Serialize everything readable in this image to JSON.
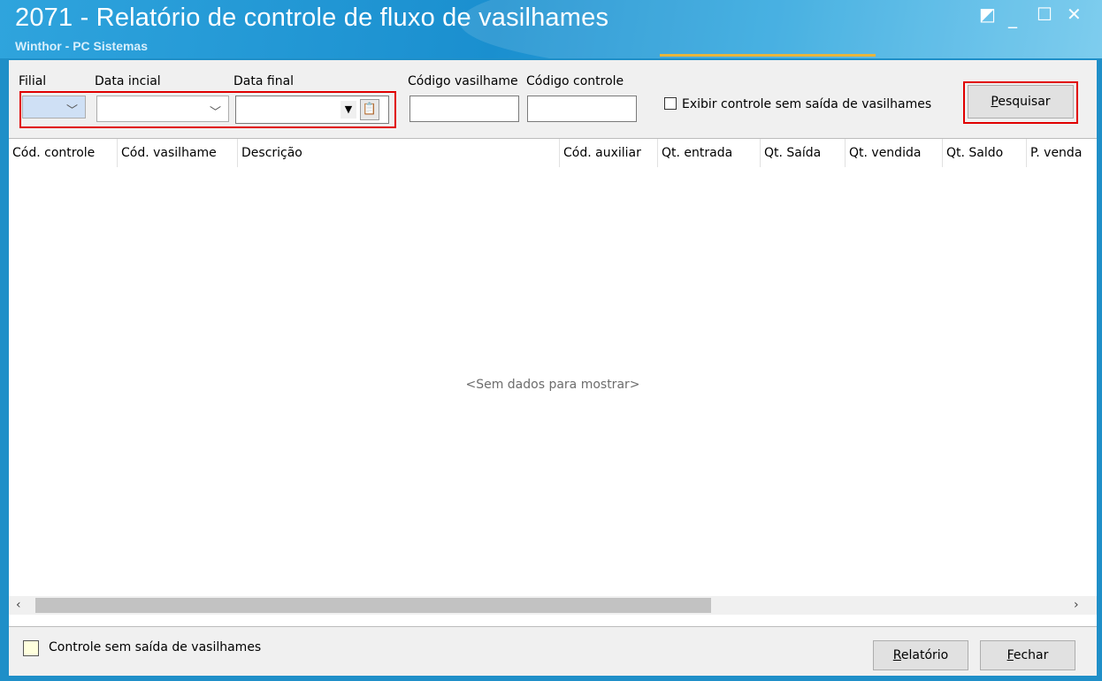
{
  "window": {
    "title": "2071 - Relatório de controle de fluxo de vasilhames",
    "subtitle": "Winthor - PC Sistemas",
    "controls": {
      "restore_icon": "◩",
      "minimize_icon": "_",
      "maximize_icon": "☐",
      "close_icon": "✕"
    }
  },
  "filters": {
    "filial_label": "Filial",
    "filial_value": "",
    "data_inicial_label": "Data incial",
    "data_inicial_value": "",
    "data_final_label": "Data final",
    "data_final_value": "",
    "codigo_vasilhame_label": "Código vasilhame",
    "codigo_vasilhame_value": "",
    "codigo_controle_label": "Código controle",
    "codigo_controle_value": "",
    "exibir_controle_label": "Exibir controle sem saída de vasilhames",
    "exibir_controle_checked": false
  },
  "buttons": {
    "pesquisar_key": "P",
    "pesquisar_rest": "esquisar",
    "relatorio_key": "R",
    "relatorio_rest": "elatório",
    "fechar_key": "F",
    "fechar_rest": "echar"
  },
  "grid": {
    "columns": [
      "Cód. controle",
      "Cód. vasilhame",
      "Descrição",
      "Cód. auxiliar",
      "Qt. entrada",
      "Qt. Saída",
      "Qt. vendida",
      "Qt. Saldo",
      "P. venda"
    ],
    "rows": [],
    "empty_text": "<Sem dados para mostrar>"
  },
  "legend": {
    "label": "Controle sem saída de vasilhames",
    "color": "#ffffdd"
  },
  "colors": {
    "titlebar": "#1a8fcf",
    "highlight": "#e00000"
  }
}
